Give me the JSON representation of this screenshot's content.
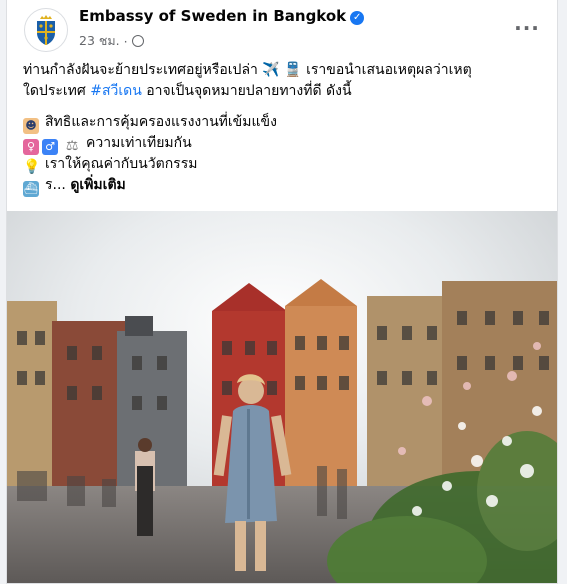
{
  "post": {
    "page_name": "Embassy of Sweden in Bangkok",
    "timestamp": "23 ชม.",
    "separator": "·",
    "more_icon": "more-horizontal-icon",
    "lines": {
      "l1_text": "ท่านกำลังฝันจะย้ายประเทศอยู่หรือเปล่า ✈️ 🚆 เราขอนำเสนอเหตุผลว่าเหตุ",
      "l2_prefix": "ใดประเทศ ",
      "l2_hashtag": "#สวีเดน",
      "l2_suffix": " อาจเป็นจุดหมายปลายทางที่ดี ดังนี้",
      "b1": "สิทธิและการคุ้มครองแรงงานที่เข้มแข็ง",
      "b2": "ความเท่าเทียมกัน",
      "b3": "เราให้คุณค่ากับนวัตกรรม",
      "b4": "ร...",
      "see_more": "ดูเพิ่มเติม"
    }
  },
  "colors": {
    "link": "#1877f2",
    "secondary": "#65676b",
    "verified": "#1877f2"
  }
}
